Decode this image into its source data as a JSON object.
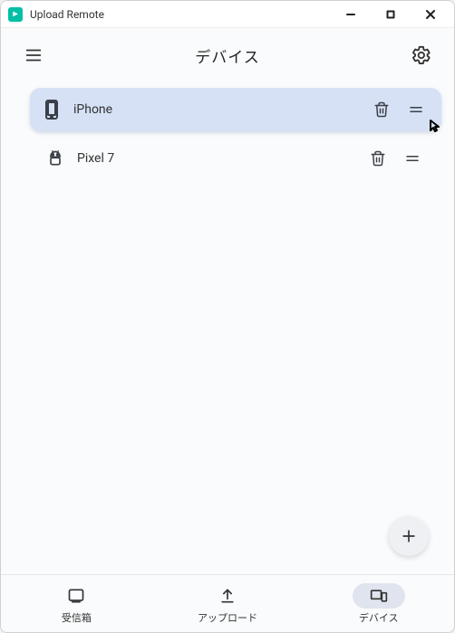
{
  "window": {
    "title": "Upload Remote"
  },
  "header": {
    "title": "デバイス"
  },
  "devices": [
    {
      "name": "iPhone",
      "type": "phone",
      "active": true
    },
    {
      "name": "Pixel 7",
      "type": "pixel",
      "active": false
    }
  ],
  "nav": {
    "inbox": {
      "label": "受信箱"
    },
    "upload": {
      "label": "アップロード"
    },
    "devices": {
      "label": "デバイス"
    }
  }
}
